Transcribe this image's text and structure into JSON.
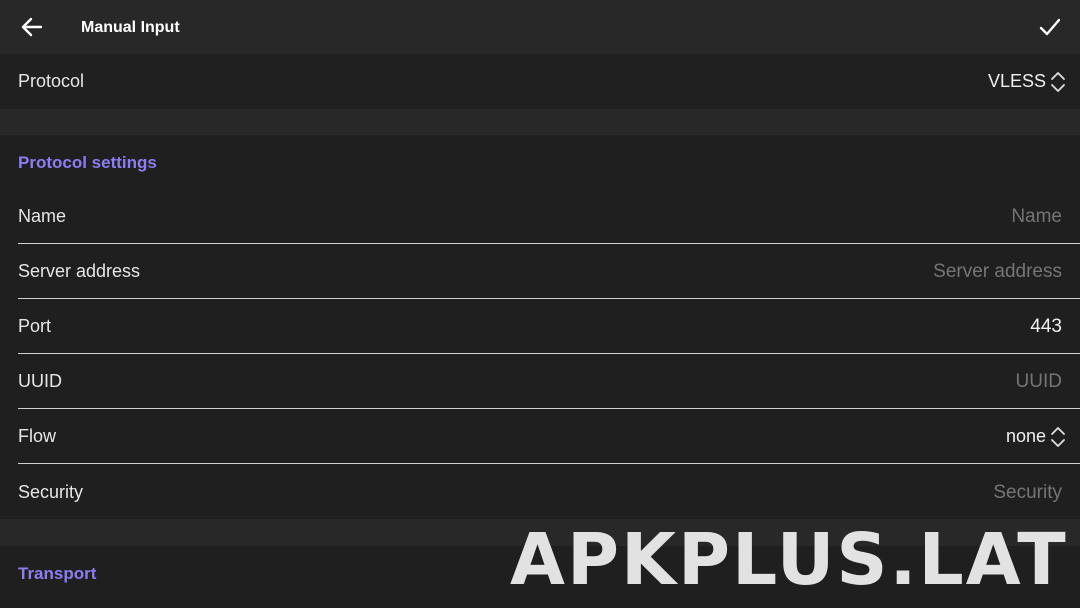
{
  "appbar": {
    "title": "Manual Input",
    "back_icon": "arrow-left-icon",
    "confirm_icon": "check-icon"
  },
  "protocol": {
    "label": "Protocol",
    "value": "VLESS"
  },
  "sections": {
    "protocol_settings": "Protocol settings",
    "transport": "Transport"
  },
  "fields": {
    "name": {
      "label": "Name",
      "placeholder": "Name",
      "value": ""
    },
    "server_address": {
      "label": "Server address",
      "placeholder": "Server address",
      "value": ""
    },
    "port": {
      "label": "Port",
      "placeholder": "",
      "value": "443"
    },
    "uuid": {
      "label": "UUID",
      "placeholder": "UUID",
      "value": ""
    },
    "flow": {
      "label": "Flow",
      "value": "none"
    },
    "security": {
      "label": "Security",
      "placeholder": "Security",
      "value": ""
    }
  },
  "watermark": "APKPLUS.LAT",
  "colors": {
    "accent": "#8c7df0",
    "background": "#1f1f1f",
    "appbar": "#282828",
    "placeholder": "#8e8e8e"
  }
}
